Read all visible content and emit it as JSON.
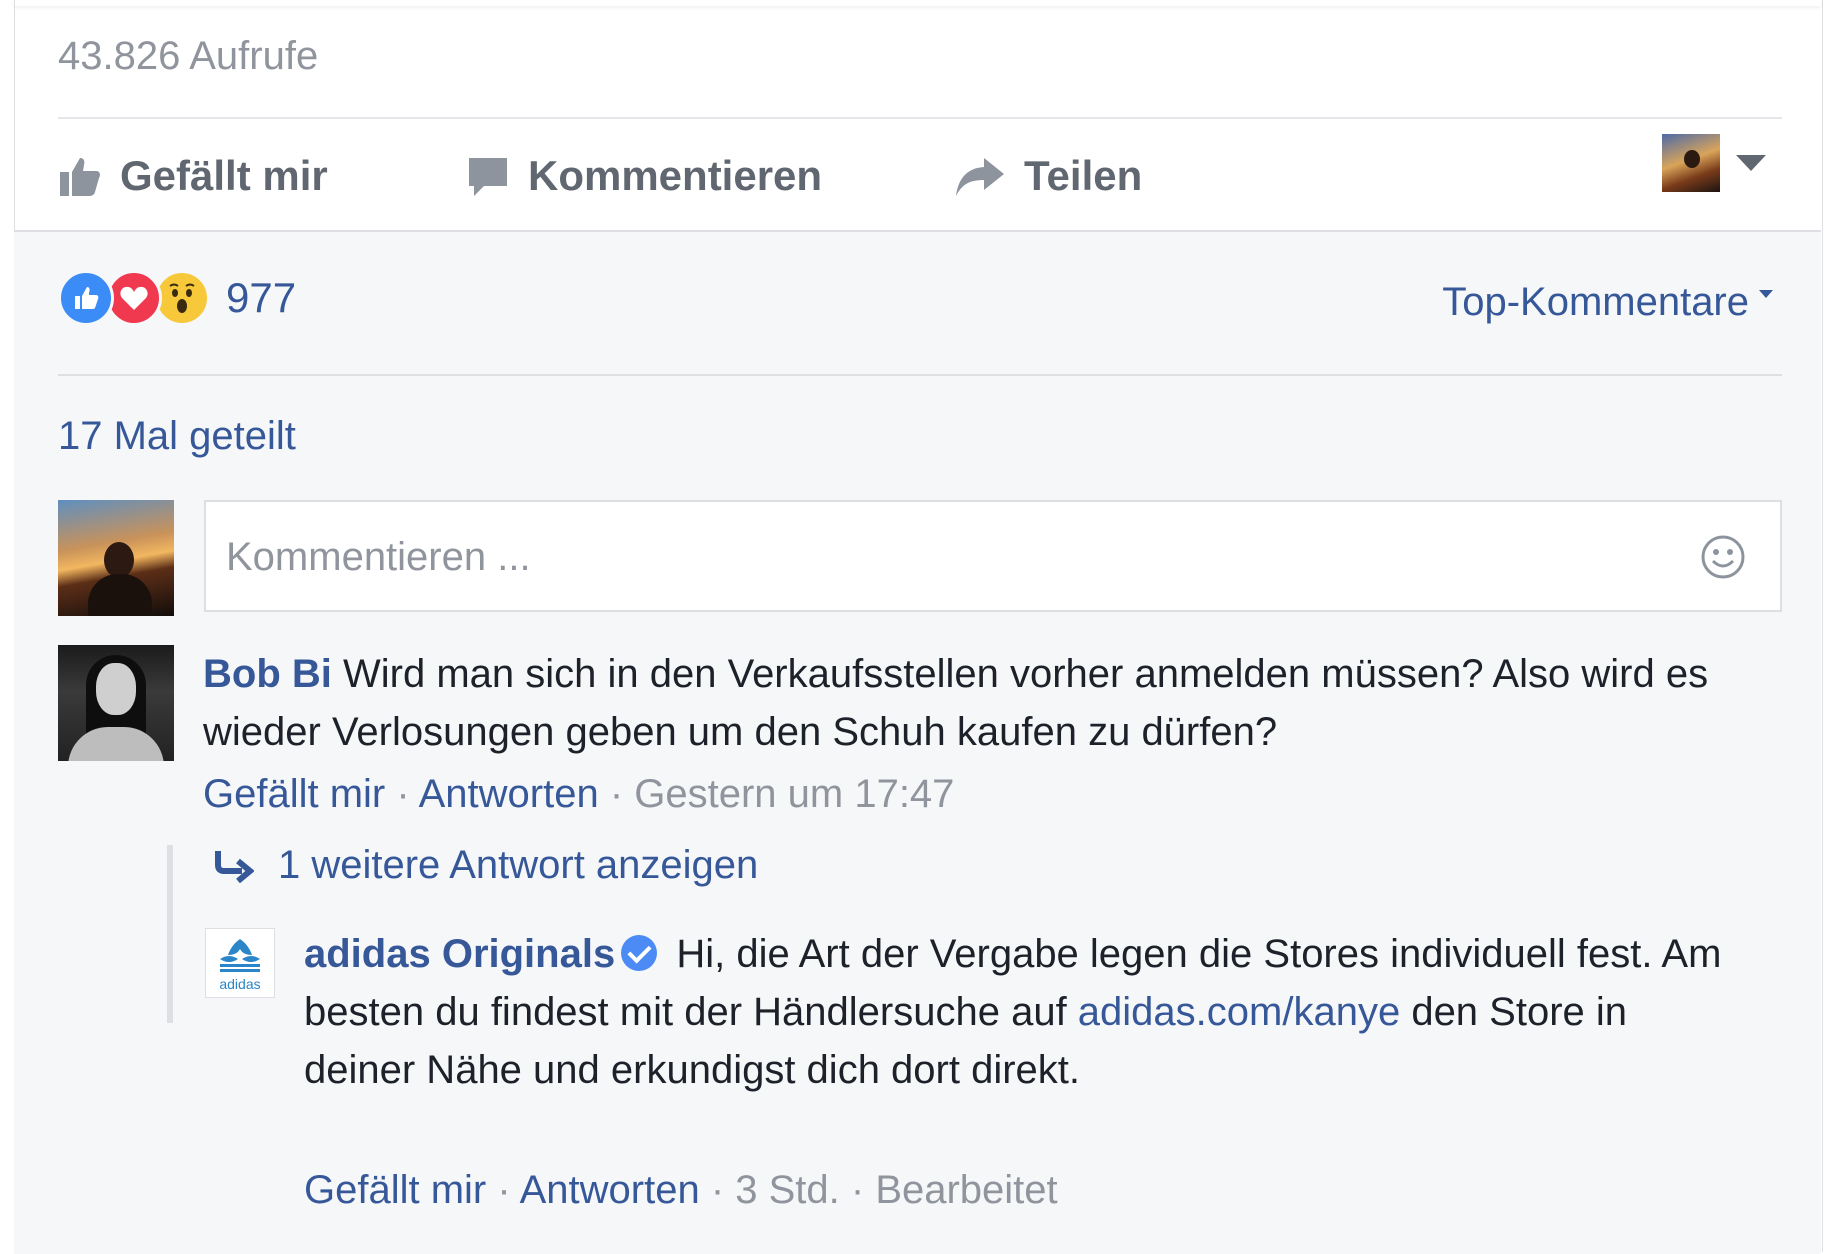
{
  "post": {
    "views": "43.826 Aufrufe"
  },
  "actions": {
    "like": "Gefällt mir",
    "comment": "Kommentieren",
    "share": "Teilen"
  },
  "reactions": {
    "types": [
      "like",
      "love",
      "wow"
    ],
    "count": "977"
  },
  "sort": {
    "label": "Top-Kommentare"
  },
  "shares": {
    "label": "17 Mal geteilt"
  },
  "composer": {
    "placeholder": "Kommentieren ..."
  },
  "comments": [
    {
      "author": "Bob Bi",
      "text": "Wird man sich in den Verkaufsstellen vorher anmelden müssen? Also wird es wieder Verlosungen geben um den Schuh kaufen zu dürfen?",
      "like_label": "Gefällt mir",
      "reply_label": "Antworten",
      "time": "Gestern um 17:47"
    }
  ],
  "replies": {
    "more_label": "1 weitere Antwort anzeigen",
    "items": [
      {
        "author": "adidas Originals",
        "verified": true,
        "text_before_link": "Hi, die Art der Vergabe legen die Stores individuell fest. Am besten du findest mit der Händlersuche auf ",
        "link": "adidas.com/kanye",
        "text_after_link": " den Store in deiner Nähe und erkundigst dich dort direkt.",
        "like_label": "Gefällt mir",
        "reply_label": "Antworten",
        "time": "3 Std.",
        "edited": "Bearbeitet",
        "logo_text": "adidas"
      }
    ]
  },
  "separator": " · ",
  "colors": {
    "link": "#365899",
    "meta": "#90949c",
    "text": "#1d2129",
    "like": "#3b8cf6",
    "love": "#f0384f",
    "wow": "#f7c93a"
  }
}
